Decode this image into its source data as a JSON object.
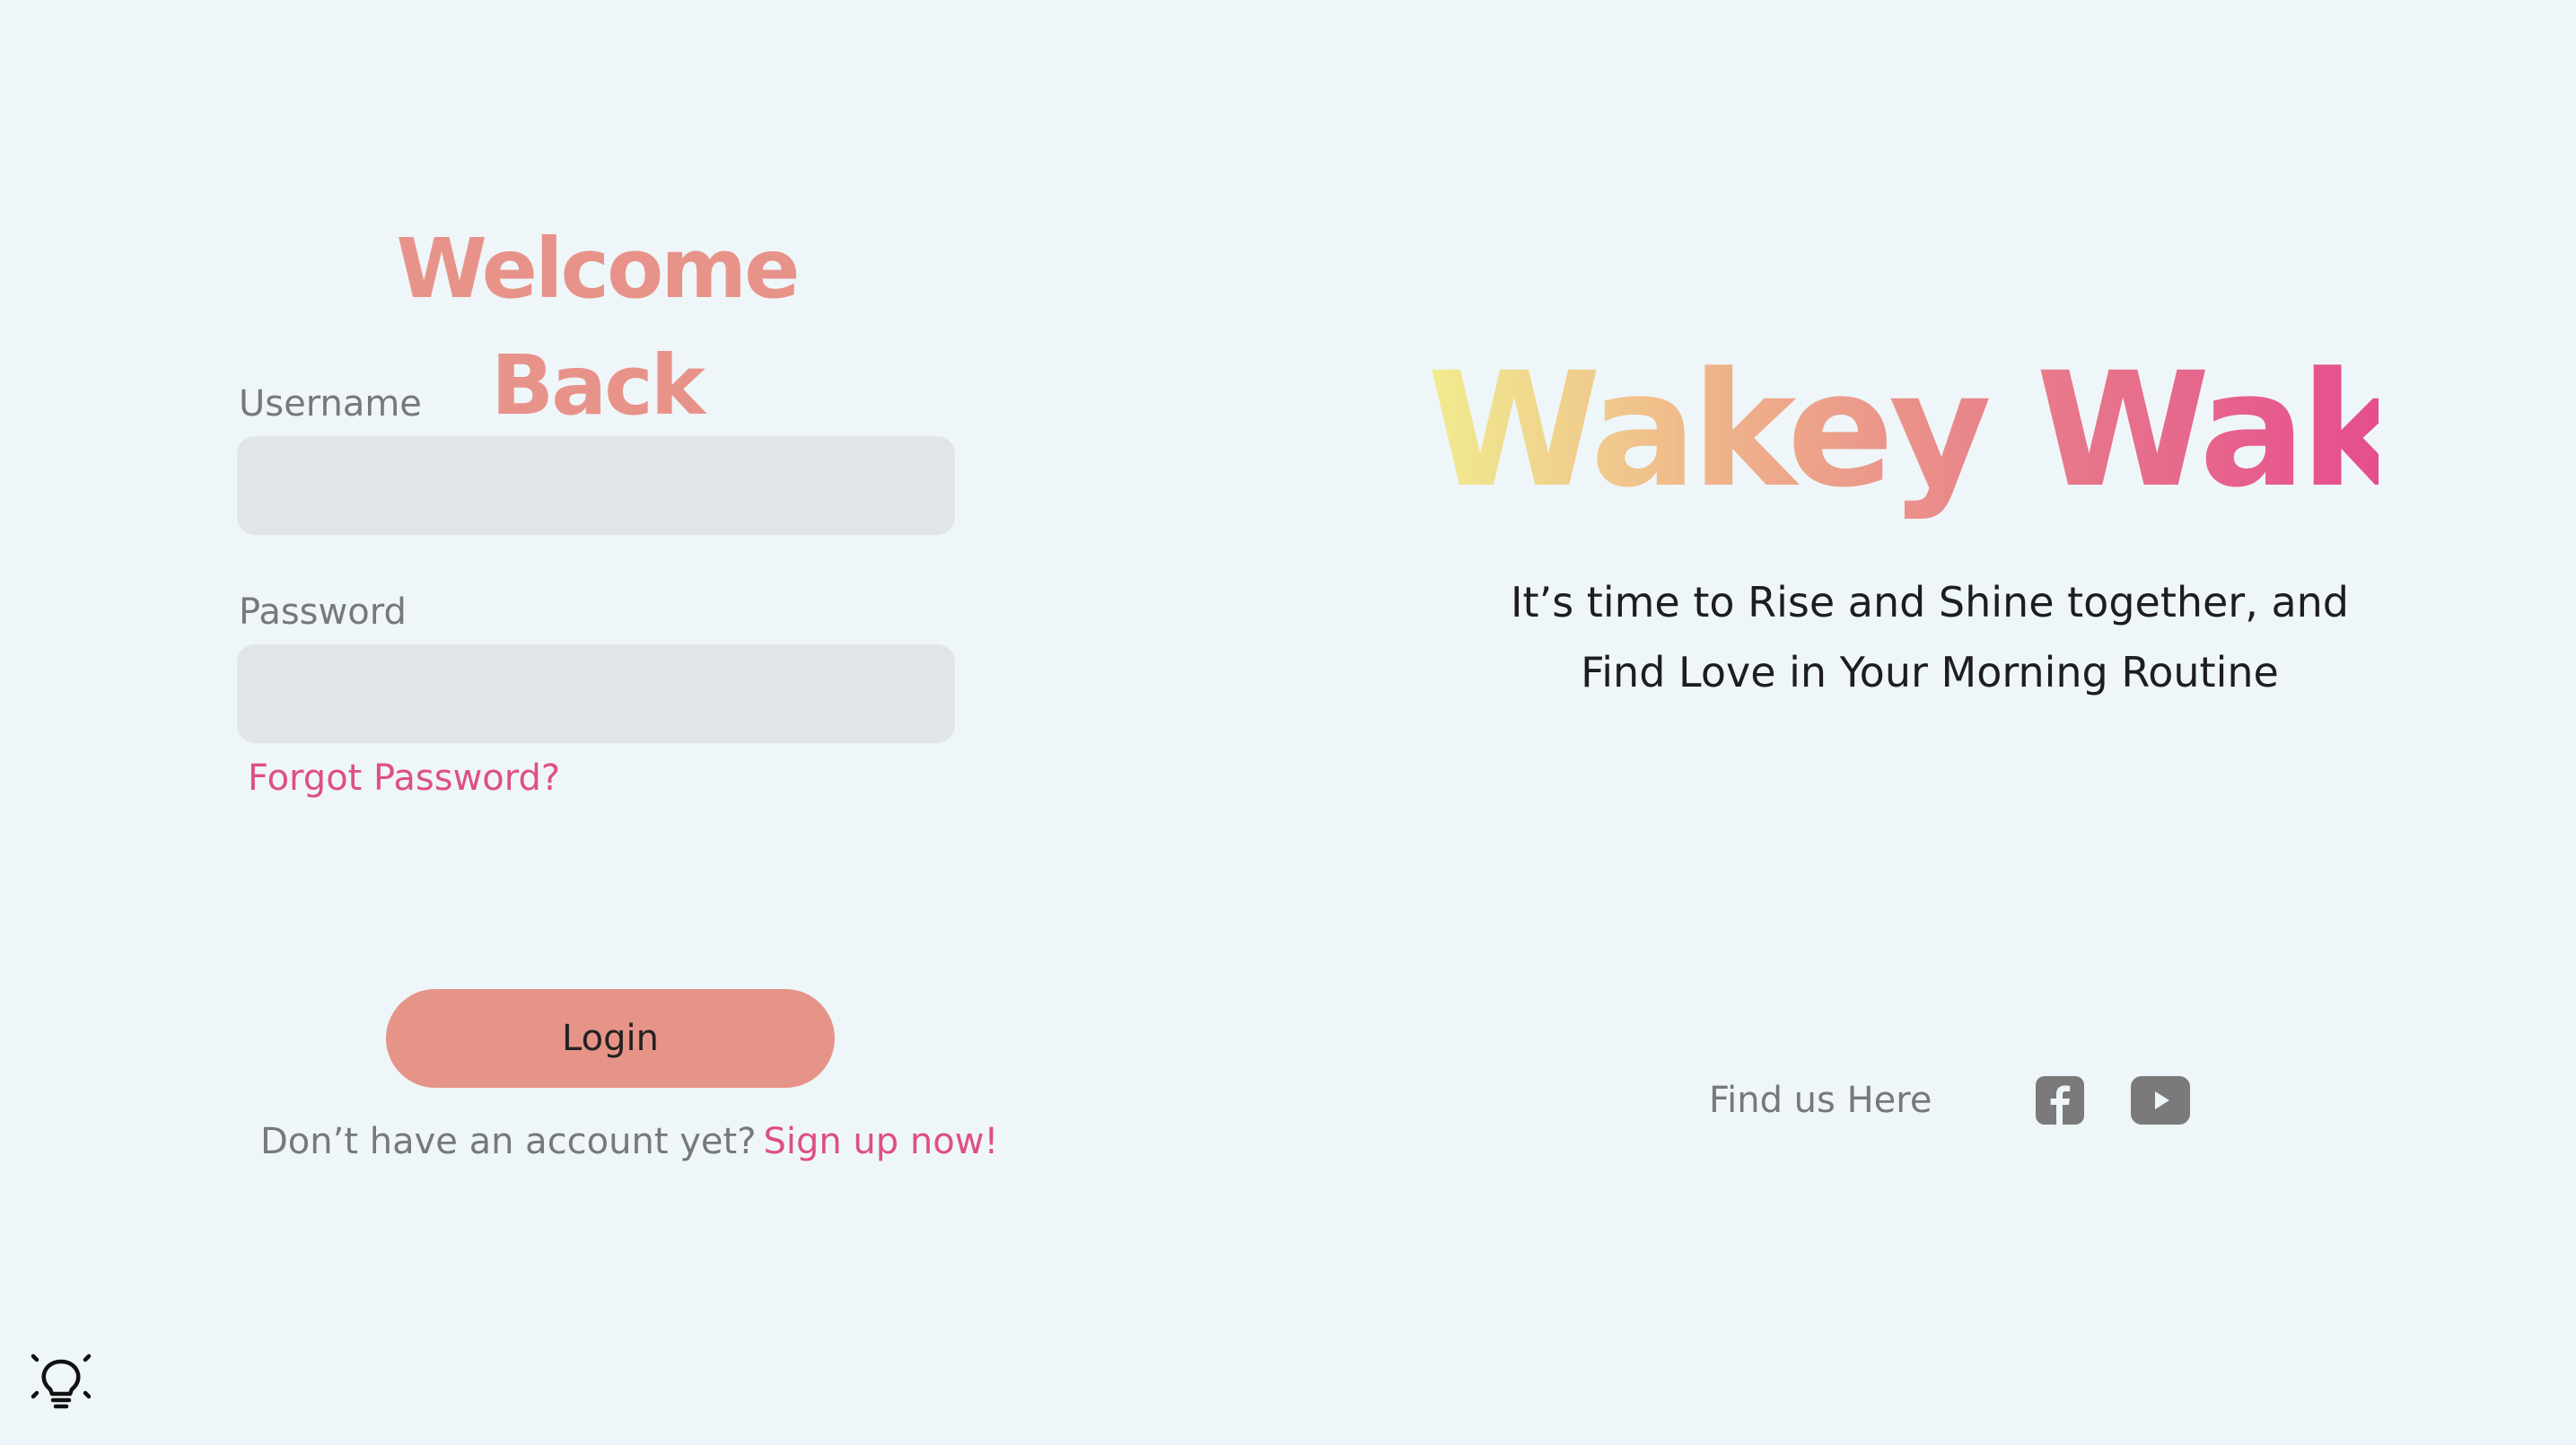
{
  "login": {
    "title": "Welcome Back",
    "username_label": "Username",
    "username_value": "",
    "password_label": "Password",
    "password_value": "",
    "forgot_password": "Forgot Password?",
    "login_button": "Login",
    "signup_prompt": "Don’t have an account yet?",
    "signup_link": "Sign up now!"
  },
  "brand": {
    "name": "Wakey Wakey",
    "tagline_line1": "It’s time to Rise and Shine together, and",
    "tagline_line2": "Find Love in Your Morning Routine",
    "gradient_colors": [
      "#f1ec8f",
      "#efb48a",
      "#e8818a",
      "#e54e8e"
    ]
  },
  "social": {
    "label": "Find us Here",
    "icons": [
      "facebook-icon",
      "youtube-icon"
    ]
  },
  "hint": {
    "icon": "lightbulb-icon"
  },
  "colors": {
    "background": "#eff6f9",
    "accent_title": "#e8938a",
    "link": "#de4f84",
    "button": "#e69488",
    "input_bg": "#e0e5e9"
  }
}
